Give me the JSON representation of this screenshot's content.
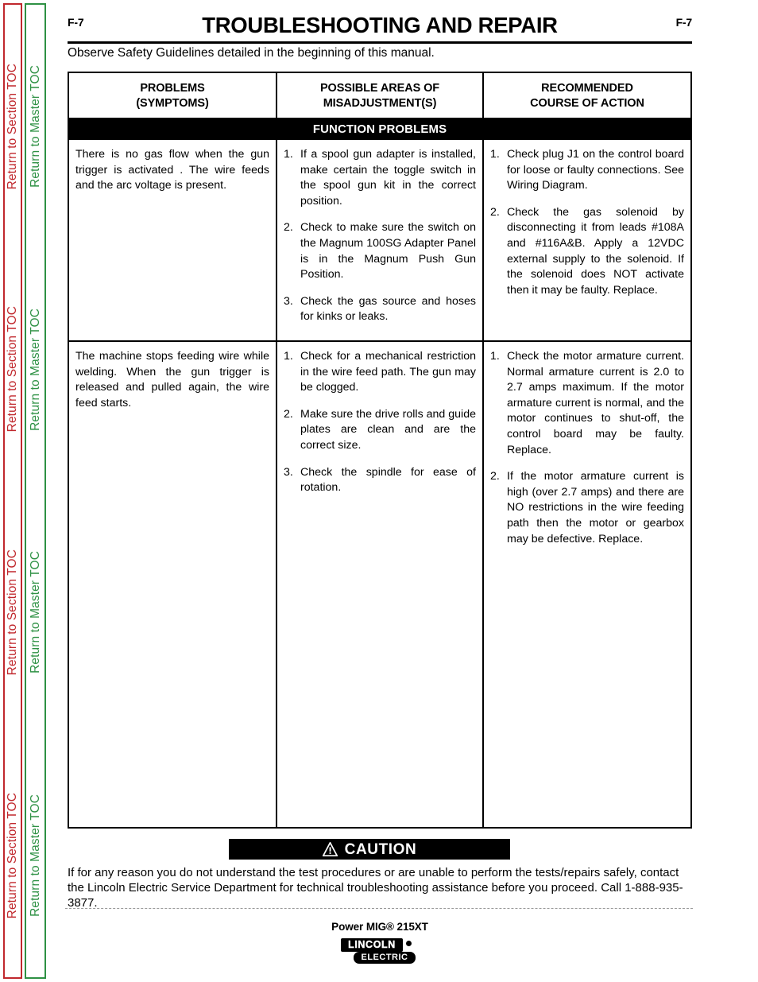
{
  "sidebar": {
    "section_toc_label": "Return to Section TOC",
    "master_toc_label": "Return to Master TOC",
    "repeat_count": 4,
    "section_color": "#c0282d",
    "master_color": "#2e9144"
  },
  "header": {
    "folio_left": "F-7",
    "folio_right": "F-7",
    "title": "TROUBLESHOOTING AND REPAIR",
    "observe_note": "Observe Safety Guidelines detailed in the beginning of this manual."
  },
  "table": {
    "columns": [
      {
        "line1": "PROBLEMS",
        "line2": "(SYMPTOMS)"
      },
      {
        "line1": "POSSIBLE AREAS OF",
        "line2": "MISADJUSTMENT(S)"
      },
      {
        "line1": "RECOMMENDED",
        "line2": "COURSE OF ACTION"
      }
    ],
    "band_label": "FUNCTION PROBLEMS",
    "rows": [
      {
        "symptom": "There is no gas flow when the gun trigger is activated .  The wire feeds and the arc voltage is present.",
        "misadjustments": [
          "If a spool gun adapter is installed, make certain the toggle switch in the spool gun kit in the correct position.",
          "Check to make sure the switch on the Magnum 100SG Adapter Panel is in the Magnum Push Gun Position.",
          "Check the gas source and hoses for kinks or leaks."
        ],
        "actions": [
          "Check plug J1 on the control board for loose or faulty connections.  See Wiring Diagram.",
          "Check the gas solenoid by disconnecting it from leads #108A and #116A&B.  Apply a 12VDC external supply to the solenoid.  If the solenoid does NOT activate then it may be faulty.  Replace."
        ]
      },
      {
        "symptom": "The machine stops feeding wire while welding.  When the gun trigger is released and pulled again, the wire feed starts.",
        "misadjustments": [
          "Check for a mechanical restriction in the wire feed path.  The gun may be clogged.",
          "Make sure the drive rolls and guide plates are clean and are the correct size.",
          "Check the spindle for ease of rotation."
        ],
        "actions": [
          "Check the motor armature current. Normal armature current is 2.0 to 2.7 amps maximum.  If the motor armature current is normal, and the motor continues to shut-off, the control board may be faulty.  Replace.",
          "If the motor armature current is high (over 2.7 amps) and there are NO restrictions in the wire feeding path then the motor or gearbox may be defective.  Replace."
        ]
      }
    ]
  },
  "caution": {
    "label": "CAUTION",
    "body": "If for any reason you do not understand the test procedures or are unable to perform the tests/repairs safely, contact the Lincoln Electric Service Department for technical troubleshooting assistance before you proceed. Call 1-888-935-3877."
  },
  "footer": {
    "model": "Power MIG® 215XT",
    "logo_line1": "LINCOLN",
    "logo_line2": "ELECTRIC"
  }
}
